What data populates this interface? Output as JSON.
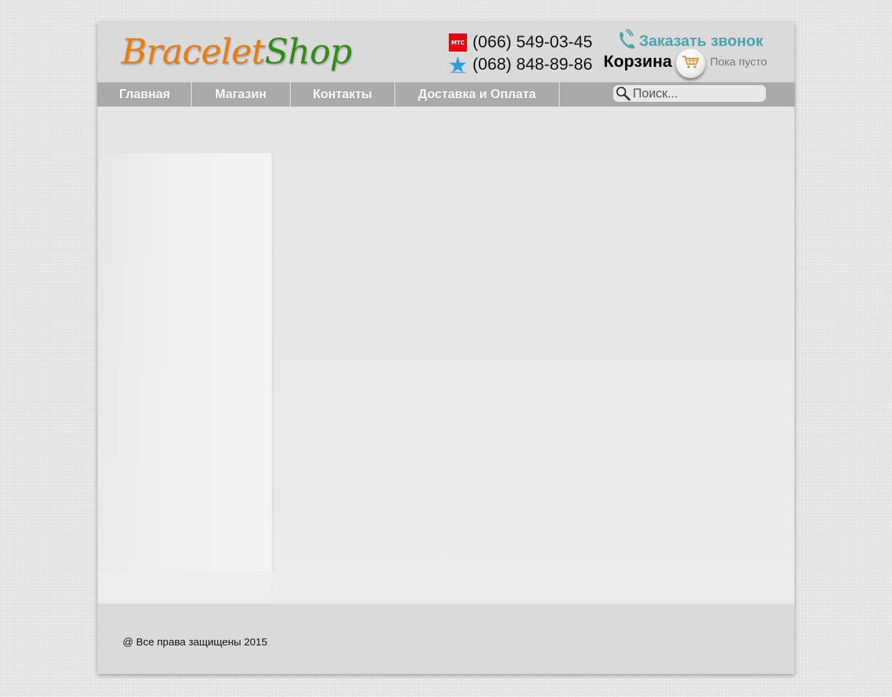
{
  "header": {
    "logo": {
      "part1": "Bracelet",
      "part2": "Shop"
    },
    "phones": [
      {
        "operator_icon": "mts-logo-icon",
        "operator_label": "МТС",
        "number": "(066) 549-03-45"
      },
      {
        "operator_icon": "kyivstar-star-icon",
        "number": "(068) 848-89-86"
      }
    ],
    "callback": {
      "icon": "phone-handset-icon",
      "label": "Заказать звонок"
    },
    "cart": {
      "label": "Корзина",
      "icon": "shopping-cart-icon",
      "status": "Пока пусто"
    }
  },
  "nav": {
    "items": [
      {
        "label": "Главная"
      },
      {
        "label": "Магазин"
      },
      {
        "label": "Контакты"
      },
      {
        "label": "Доставка и Оплата"
      }
    ],
    "search": {
      "icon": "search-icon",
      "placeholder": "Поиск..."
    }
  },
  "footer": {
    "copyright": "@ Все права защищены 2015"
  },
  "colors": {
    "logo_orange": "#e87d0d",
    "logo_green": "#2f8f14",
    "callback_teal": "#4aa3ad",
    "nav_bg": "#a9a9a9",
    "mts_red": "#e30613",
    "kyivstar_blue": "#2a9fd8"
  }
}
